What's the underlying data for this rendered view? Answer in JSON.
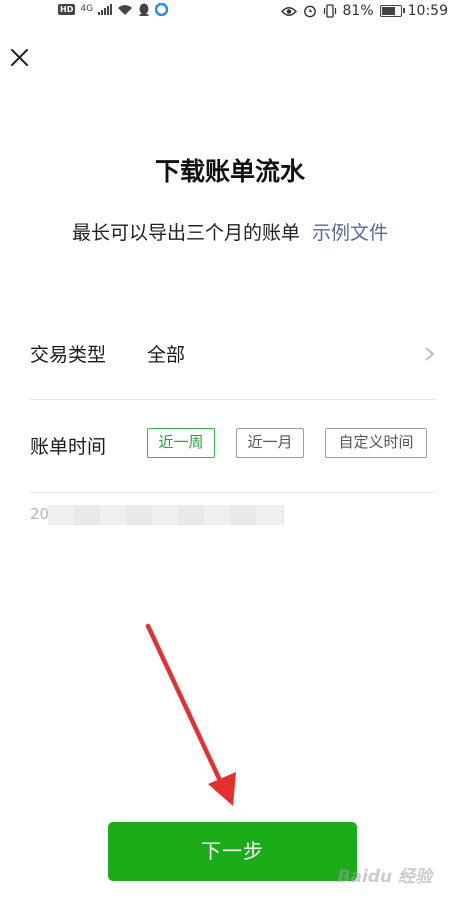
{
  "status_bar": {
    "left_badge": "HD",
    "signal": "4G",
    "battery_percent": "81%",
    "battery_level": 0.81,
    "time": "10:59"
  },
  "header": {
    "close_icon": "close-icon"
  },
  "main": {
    "title": "下载账单流水",
    "subtitle": "最长可以导出三个月的账单",
    "example_link": "示例文件",
    "type_label": "交易类型",
    "type_value": "全部",
    "time_label": "账单时间",
    "time_options": [
      "近一周",
      "近一月",
      "自定义时间"
    ],
    "selected_time": "近一周",
    "date_prefix": "20"
  },
  "footer": {
    "next_button": "下一步"
  },
  "watermark": "Baidu 经验",
  "colors": {
    "primary_green": "#1aad19",
    "link_blue": "#576b95",
    "annotation_red": "#e63030"
  }
}
